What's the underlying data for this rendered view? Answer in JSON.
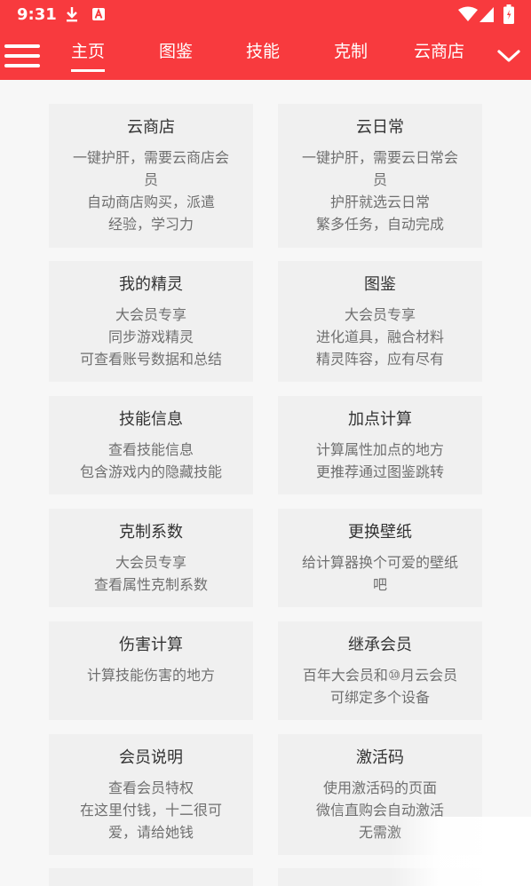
{
  "status_bar": {
    "time": "9:31",
    "icons": [
      "download-icon",
      "a-app-icon",
      "wifi-icon",
      "signal-icon",
      "battery-icon"
    ]
  },
  "nav": {
    "menu_icon": "hamburger-menu-icon",
    "tabs": [
      {
        "label": "主页",
        "active": true
      },
      {
        "label": "图鉴",
        "active": false
      },
      {
        "label": "技能",
        "active": false
      },
      {
        "label": "克制",
        "active": false
      },
      {
        "label": "云商店",
        "active": false
      }
    ],
    "more_icon": "chevron-down-icon"
  },
  "cards": [
    {
      "title": "云商店",
      "desc": "一键护肝，需要云商店会\n员\n自动商店购买，派遣\n经验，学习力"
    },
    {
      "title": "云日常",
      "desc": "一键护肝，需要云日常会\n员\n护肝就选云日常\n繁多任务，自动完成"
    },
    {
      "title": "我的精灵",
      "desc": "大会员专享\n同步游戏精灵\n可查看账号数据和总结"
    },
    {
      "title": "图鉴",
      "desc": "大会员专享\n进化道具，融合材料\n精灵阵容，应有尽有"
    },
    {
      "title": "技能信息",
      "desc": "查看技能信息\n包含游戏内的隐藏技能"
    },
    {
      "title": "加点计算",
      "desc": "计算属性加点的地方\n更推荐通过图鉴跳转"
    },
    {
      "title": "克制系数",
      "desc": "大会员专享\n查看属性克制系数"
    },
    {
      "title": "更换壁纸",
      "desc": "给计算器换个可爱的壁纸\n吧"
    },
    {
      "title": "伤害计算",
      "desc": "计算技能伤害的地方"
    },
    {
      "title": "继承会员",
      "desc": "百年大会员和⑩月云会员\n可绑定多个设备"
    },
    {
      "title": "会员说明",
      "desc": "查看会员特权\n在这里付钱，十二很可\n爱，请给她钱"
    },
    {
      "title": "激活码",
      "desc": "使用激活码的页面\n微信直购会自动激活\n无需激"
    }
  ],
  "colors": {
    "primary": "#f83a3e",
    "background": "#f7f7f7",
    "card": "#f0f0f0",
    "title_text": "#333333",
    "desc_text": "#6f6f6f"
  }
}
